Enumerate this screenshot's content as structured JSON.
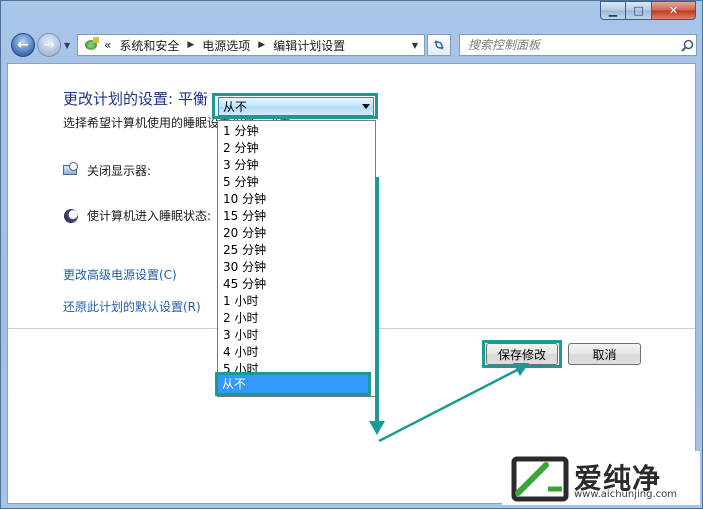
{
  "window": {
    "caption": {
      "minimize": "▁",
      "maximize": "□",
      "close": "✕"
    }
  },
  "nav": {
    "back_icon": "←",
    "forward_icon": "→",
    "address": {
      "prefix": "«",
      "crumbs": [
        "系统和安全",
        "电源选项",
        "编辑计划设置"
      ],
      "separator": "▶"
    },
    "refresh_icon": "refresh-arrows-icon",
    "search": {
      "placeholder": "搜索控制面板"
    }
  },
  "main": {
    "heading": "更改计划的设置: 平衡",
    "subtext": "选择希望计算机使用的睡眠设置和显示设置。",
    "display_off": {
      "label": "关闭显示器:",
      "selected": "从不",
      "options": [
        "1 分钟",
        "2 分钟",
        "3 分钟",
        "5 分钟",
        "10 分钟",
        "15 分钟",
        "20 分钟",
        "25 分钟",
        "30 分钟",
        "45 分钟",
        "1 小时",
        "2 小时",
        "3 小时",
        "4 小时",
        "5 小时",
        "从不"
      ],
      "highlighted_option": "从不"
    },
    "sleep": {
      "label": "使计算机进入睡眠状态:"
    },
    "links": {
      "advanced": "更改高级电源设置(C)",
      "restore": "还原此计划的默认设置(R)"
    },
    "buttons": {
      "save": "保存修改",
      "cancel": "取消"
    }
  },
  "annotation_color": "#1a9a93",
  "watermark": {
    "name": "爱纯净",
    "url": "www.aichunjing.com"
  }
}
